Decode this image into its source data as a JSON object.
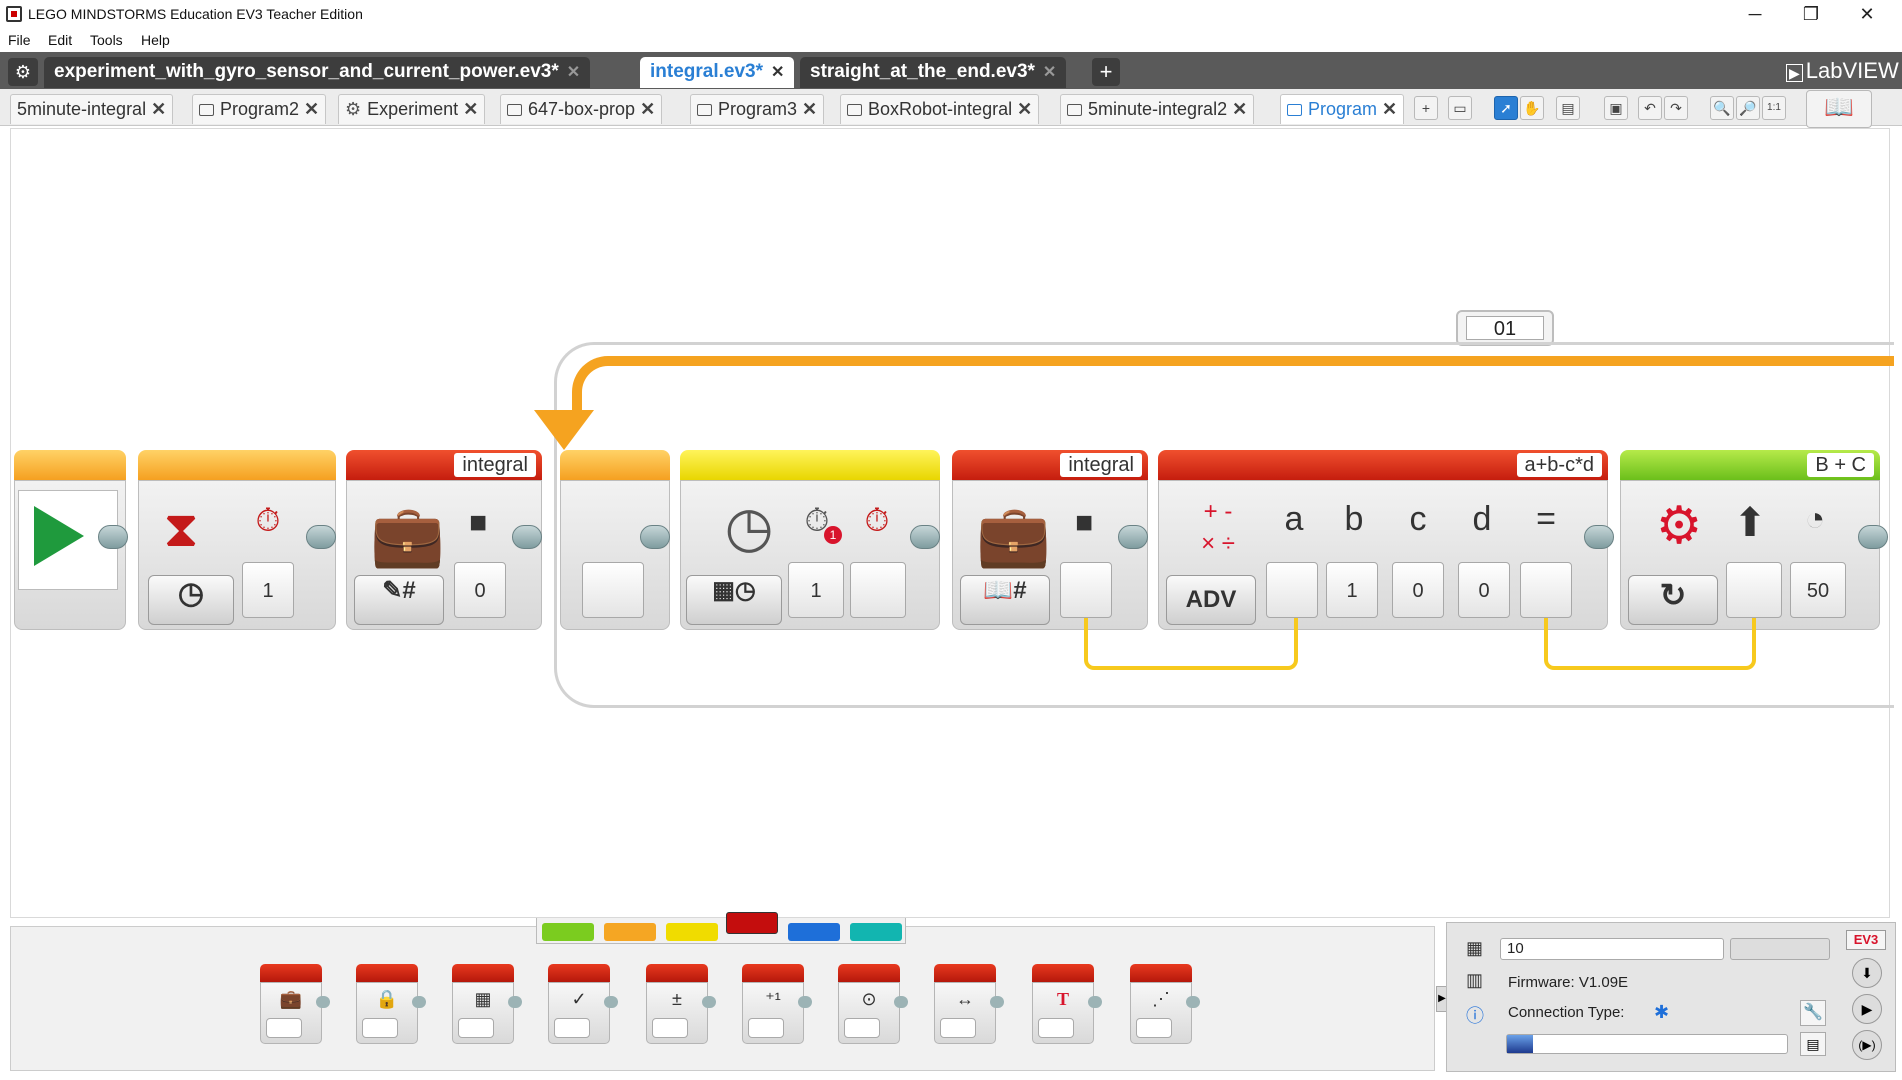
{
  "window": {
    "title": "LEGO MINDSTORMS Education EV3 Teacher Edition",
    "minimize": "─",
    "restore": "❐",
    "close": "✕"
  },
  "menu": [
    "File",
    "Edit",
    "Tools",
    "Help"
  ],
  "file_tabs": [
    {
      "label": "experiment_with_gyro_sensor_and_current_power.ev3*",
      "active": false
    },
    {
      "label": "integral.ev3*",
      "active": true
    },
    {
      "label": "straight_at_the_end.ev3*",
      "active": false
    }
  ],
  "file_tab_add": "+",
  "labview": "LabVIEW",
  "program_tabs": [
    {
      "label": "5minute-integral",
      "active": false
    },
    {
      "label": "Program2",
      "active": false
    },
    {
      "label": "Experiment",
      "active": false
    },
    {
      "label": "647-box-prop",
      "active": false
    },
    {
      "label": "Program3",
      "active": false
    },
    {
      "label": "BoxRobot-integral",
      "active": false
    },
    {
      "label": "5minute-integral2",
      "active": false
    },
    {
      "label": "Program",
      "active": true
    }
  ],
  "tab_close": "✕",
  "loop": {
    "name": "01"
  },
  "blocks": {
    "wait_value": "1",
    "var1_name": "integral",
    "var1_value": "0",
    "timer_value": "1",
    "var2_name": "integral",
    "math_label": "a+b-c*d",
    "math_mode": "ADV",
    "math_vars": [
      "a",
      "b",
      "c",
      "d",
      "="
    ],
    "math_b": "1",
    "math_c": "0",
    "math_d": "0",
    "steer_ports": "B + C",
    "steer_power": "50"
  },
  "palette_colors": [
    "#7bcc1f",
    "#f5a623",
    "#f0dc00",
    "#c40d0d",
    "#1e6fd9",
    "#12b5b0"
  ],
  "palette_active": 3,
  "palette_icons": [
    "💼",
    "🔒",
    "▦",
    "✓",
    "±",
    "⁺¹",
    "⊙",
    "↔",
    "T",
    "⋰"
  ],
  "hardware": {
    "brick_name": "10",
    "firmware": "Firmware: V1.09E",
    "connection": "Connection Type:",
    "ev3": "EV3"
  }
}
